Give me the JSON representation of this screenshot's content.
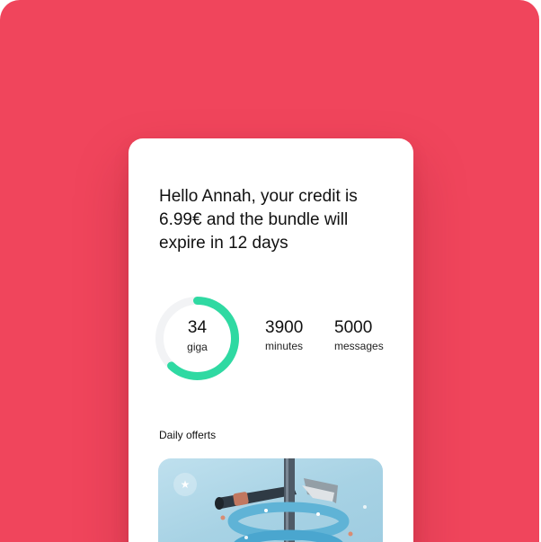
{
  "colors": {
    "brand_background": "#f0455c",
    "card_background": "#ffffff",
    "ring_accent": "#2fd9a2",
    "ring_track": "#f2f3f5"
  },
  "greeting": "Hello Annah, your credit is 6.99€ and the bundle will expire in 12 days",
  "usage": {
    "data": {
      "value": "34",
      "unit": "giga",
      "remaining_fraction": 0.62
    },
    "minutes": {
      "value": "3900",
      "unit": "minutes"
    },
    "messages": {
      "value": "5000",
      "unit": "messages"
    }
  },
  "offers": {
    "title": "Daily offerts",
    "favorite_icon": "star-icon"
  }
}
